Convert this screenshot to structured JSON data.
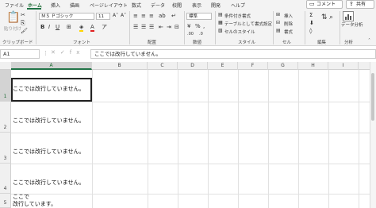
{
  "menu": {
    "tabs": [
      "ファイル",
      "ホーム",
      "挿入",
      "描画",
      "ページレイアウト",
      "数式",
      "データ",
      "校閲",
      "表示",
      "開発",
      "ヘルプ"
    ],
    "active_tab": "ホーム",
    "comment_label": "コメント",
    "share_label": "共有"
  },
  "ribbon": {
    "clipboard": {
      "paste_label": "貼り付け",
      "group_label": "クリップボード"
    },
    "font": {
      "font_name": "ＭＳ Ｐゴシック",
      "font_size": "11",
      "group_label": "フォント"
    },
    "alignment": {
      "group_label": "配置"
    },
    "number": {
      "format": "標準",
      "group_label": "数値"
    },
    "styles": {
      "conditional": "条件付き書式",
      "table": "テーブルとして書式設定",
      "cell_styles": "セルのスタイル",
      "group_label": "スタイル"
    },
    "cells": {
      "insert": "挿入",
      "delete": "削除",
      "format": "書式",
      "group_label": "セル"
    },
    "editing": {
      "group_label": "編集"
    },
    "analysis": {
      "button_label": "データ分析",
      "group_label": "分析"
    }
  },
  "formula_bar": {
    "name_box": "A1",
    "formula": "ここでは改行していません。"
  },
  "sheet": {
    "columns": [
      "A",
      "B",
      "C",
      "D",
      "E",
      "F",
      "G",
      "H",
      "I"
    ],
    "selected_column": "A",
    "rows": [
      "1",
      "2",
      "3",
      "4",
      "5"
    ],
    "selected_row": "1",
    "cells_A": [
      "ここでは改行していません。",
      "ここでは改行していません。",
      "ここでは改行していません。",
      "ここでは改行していません。",
      "ここで\n改行しています。"
    ]
  },
  "colors": {
    "accent": "#217346",
    "ribbon_bg": "#f3f3f3"
  }
}
